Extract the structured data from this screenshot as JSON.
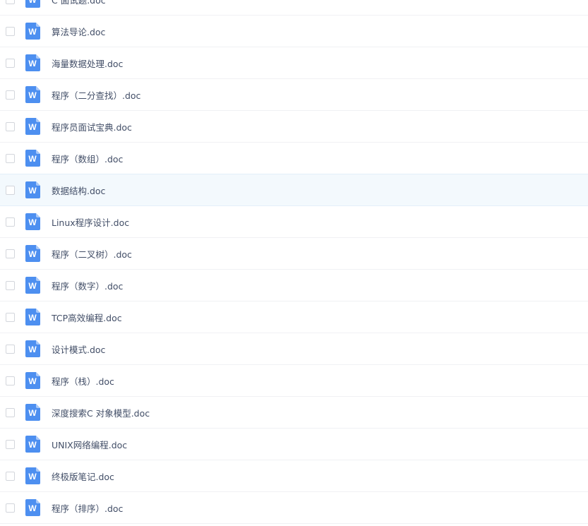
{
  "file_icon": {
    "name": "word-doc-icon",
    "letter": "W",
    "color": "#4d8ff0",
    "fold_color": "#a8c8f8"
  },
  "files": [
    {
      "name": "C 面试题.doc"
    },
    {
      "name": "算法导论.doc"
    },
    {
      "name": "海量数据处理.doc"
    },
    {
      "name": "程序（二分查找）.doc"
    },
    {
      "name": "程序员面试宝典.doc"
    },
    {
      "name": "程序（数组）.doc"
    },
    {
      "name": "数据结构.doc",
      "hover": true
    },
    {
      "name": "Linux程序设计.doc"
    },
    {
      "name": "程序（二叉树）.doc"
    },
    {
      "name": "程序（数字）.doc"
    },
    {
      "name": "TCP高效编程.doc"
    },
    {
      "name": "设计模式.doc"
    },
    {
      "name": "程序（栈）.doc"
    },
    {
      "name": "深度搜索C 对象模型.doc"
    },
    {
      "name": "UNIX网络编程.doc"
    },
    {
      "name": "终极版笔记.doc"
    },
    {
      "name": "程序（排序）.doc"
    }
  ]
}
